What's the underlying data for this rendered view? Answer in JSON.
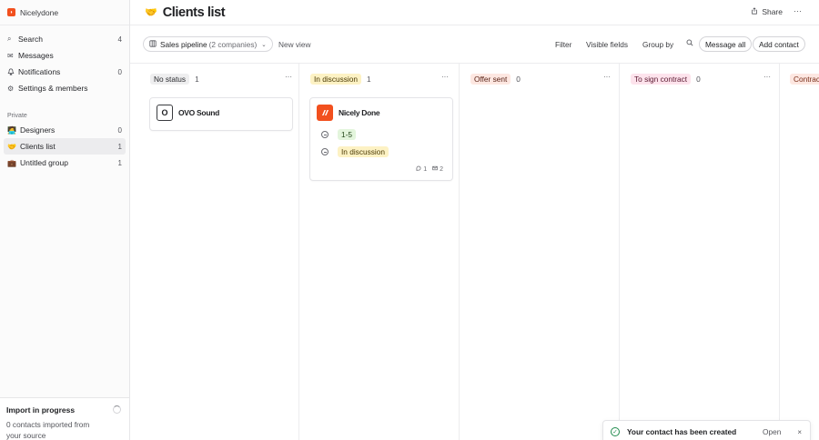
{
  "workspace": {
    "name": "Nicelydone"
  },
  "sidebar": {
    "nav": [
      {
        "label": "Search",
        "count": "4",
        "icon": "search-icon",
        "glyph": "⌕"
      },
      {
        "label": "Messages",
        "count": "",
        "icon": "mail-icon",
        "glyph": "✉"
      },
      {
        "label": "Notifications",
        "count": "0",
        "icon": "bell-icon",
        "glyph": "♫"
      },
      {
        "label": "Settings & members",
        "count": "",
        "icon": "gear-icon",
        "glyph": "⚙"
      }
    ],
    "private_title": "Private",
    "lists": [
      {
        "label": "Designers",
        "count": "0",
        "emoji": "🧑‍💻"
      },
      {
        "label": "Clients list",
        "count": "1",
        "emoji": "🤝"
      },
      {
        "label": "Untitled group",
        "count": "1",
        "emoji": "💼"
      }
    ],
    "import": {
      "title": "Import in progress",
      "text": "0 contacts imported from your source"
    }
  },
  "header": {
    "emoji": "🤝",
    "title": "Clients list",
    "share": "Share",
    "more": "···"
  },
  "toolbar": {
    "view_name": "Sales pipeline",
    "view_count": "(2 companies)",
    "new_view": "New view",
    "filter": "Filter",
    "visible_fields": "Visible fields",
    "group_by": "Group by",
    "message_all": "Message all",
    "add_contact": "Add contact"
  },
  "columns": [
    {
      "label": "No status",
      "count": "1",
      "bg": "#eeeeef",
      "fg": "#2a2b2f"
    },
    {
      "label": "In discussion",
      "count": "1",
      "bg": "#fdf2c4",
      "fg": "#4a3a05"
    },
    {
      "label": "Offer sent",
      "count": "0",
      "bg": "#fde7e1",
      "fg": "#5a2418"
    },
    {
      "label": "To sign contract",
      "count": "0",
      "bg": "#fde3ec",
      "fg": "#5a1830"
    },
    {
      "label": "Contrac",
      "count": "",
      "bg": "#fde7e1",
      "fg": "#7a2f1a"
    }
  ],
  "cards": {
    "ovo": {
      "initial": "O",
      "name": "OVO Sound"
    },
    "nd": {
      "name": "Nicely Done",
      "size": "1-5",
      "status": "In discussion",
      "comments": "1",
      "messages": "2"
    }
  },
  "toast": {
    "message": "Your contact has been created",
    "open": "Open",
    "close": "×"
  }
}
